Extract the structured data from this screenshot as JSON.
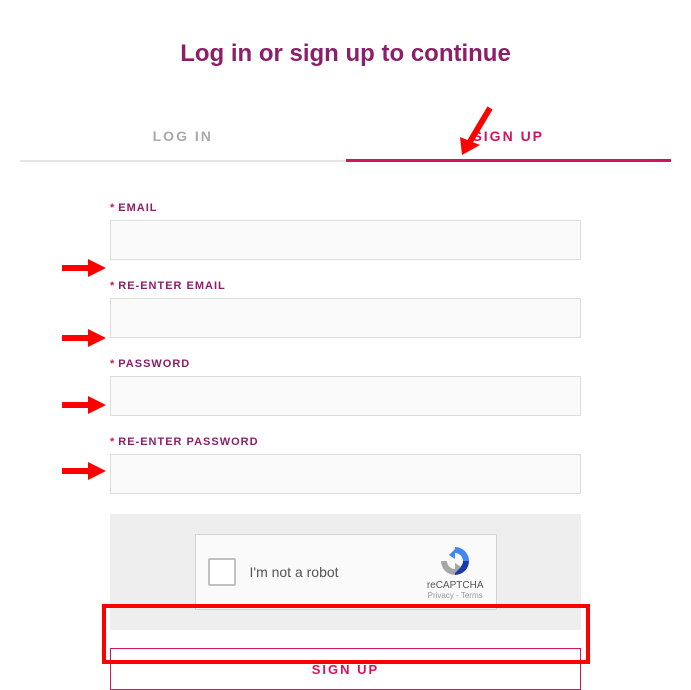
{
  "header": {
    "title": "Log in or sign up to continue"
  },
  "tabs": {
    "login": "LOG IN",
    "signup": "SIGN UP"
  },
  "form": {
    "email_label": "EMAIL",
    "reemail_label": "RE-ENTER EMAIL",
    "password_label": "PASSWORD",
    "repassword_label": "RE-ENTER PASSWORD",
    "email_value": "",
    "reemail_value": "",
    "password_value": "",
    "repassword_value": ""
  },
  "captcha": {
    "label": "I'm not a robot",
    "brand": "reCAPTCHA",
    "privacy": "Privacy",
    "separator": " - ",
    "terms": "Terms"
  },
  "submit": {
    "label": "SIGN UP"
  }
}
